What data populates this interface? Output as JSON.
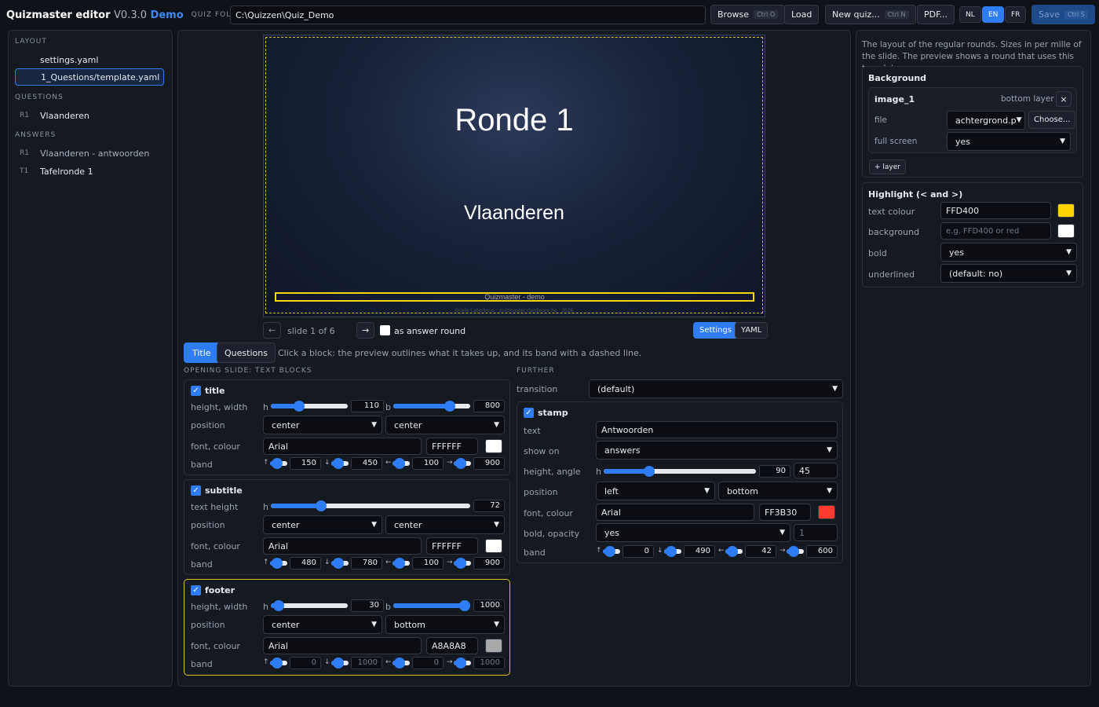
{
  "app": {
    "title": "Quizmaster editor",
    "version": "V0.3.0",
    "edition": "Demo",
    "folder_label": "QUIZ FOLDER",
    "folder_value": "C:\\Quizzen\\Quiz_Demo"
  },
  "toolbar": {
    "browse": "Browse",
    "browse_kbd": "Ctrl O",
    "load": "Load",
    "new_quiz": "New quiz...",
    "new_kbd": "Ctrl N",
    "pdf": "PDF...",
    "lang_nl": "NL",
    "lang_en": "EN",
    "lang_fr": "FR",
    "save": "Save",
    "save_kbd": "Ctrl S"
  },
  "sidebar": {
    "layout_title": "LAYOUT",
    "layout_items": [
      "settings.yaml",
      "1_Questions/template.yaml"
    ],
    "questions_title": "QUESTIONS",
    "questions": [
      {
        "code": "R1",
        "name": "Vlaanderen"
      }
    ],
    "answers_title": "ANSWERS",
    "answers": [
      {
        "code": "R1",
        "name": "Vlaanderen - antwoorden"
      },
      {
        "code": "T1",
        "name": "Tafelronde 1"
      }
    ]
  },
  "preview": {
    "title": "Ronde 1",
    "subtitle": "Vlaanderen",
    "footer": "Quizmaster - demo",
    "credits": "Griele Caterbous · quizmaster.clardware.be · 2026",
    "slide_label": "slide 1 of 6",
    "prev": "←",
    "next": "→",
    "answer_round": "as answer round",
    "settings": "Settings",
    "yaml": "YAML"
  },
  "tabs": {
    "title": "Title",
    "questions": "Questions",
    "hint": "Click a block: the preview outlines what it takes up, and its band with a dashed line."
  },
  "blocks": {
    "section_title": "OPENING SLIDE: TEXT BLOCKS",
    "labels": {
      "height_width": "height, width",
      "position": "position",
      "font_colour": "font, colour",
      "band": "band",
      "text_height": "text height",
      "h": "h",
      "b": "b",
      "up": "↑",
      "down": "↓",
      "left": "←",
      "right": "→"
    },
    "title": {
      "name": "title",
      "h": 110,
      "w": 800,
      "h_frac": 0.37,
      "w_frac": 0.73,
      "pos1": "center",
      "pos2": "center",
      "font": "Arial",
      "colour": "FFFFFF",
      "swatch": "#ffffff",
      "band": [
        150,
        450,
        100,
        900
      ]
    },
    "subtitle": {
      "name": "subtitle",
      "h": 72,
      "h_frac": 0.25,
      "pos1": "center",
      "pos2": "center",
      "font": "Arial",
      "colour": "FFFFFF",
      "swatch": "#ffffff",
      "band": [
        480,
        780,
        100,
        900
      ]
    },
    "footer": {
      "name": "footer",
      "h": 30,
      "w": 1000,
      "h_frac": 0.1,
      "w_frac": 1.0,
      "pos1": "center",
      "pos2": "bottom",
      "font": "Arial",
      "colour": "A8A8A8",
      "swatch": "#a8a8a8",
      "band": [
        0,
        1000,
        0,
        1000
      ]
    }
  },
  "further": {
    "section_title": "FURTHER",
    "transition_label": "transition",
    "transition_value": "(default)",
    "stamp": {
      "name": "stamp",
      "text_label": "text",
      "text": "Antwoorden",
      "show_label": "show on",
      "show": "answers",
      "ha_label": "height, angle",
      "h": 90,
      "angle": 45,
      "h_frac": 0.3,
      "pos_label": "position",
      "pos1": "left",
      "pos2": "bottom",
      "fc_label": "font, colour",
      "font": "Arial",
      "colour": "FF3B30",
      "swatch": "#ff3b30",
      "bo_label": "bold, opacity",
      "bold": "yes",
      "opacity": "1",
      "band_label": "band",
      "band": [
        0,
        490,
        42,
        600
      ]
    }
  },
  "right": {
    "intro": "The layout of the regular rounds. Sizes in per mille of the slide. The preview shows a round that uses this template.",
    "background": {
      "title": "Background",
      "layer": "image_1",
      "layer_pos": "bottom layer",
      "close": "×",
      "file_label": "file",
      "file": "achtergrond.p",
      "choose": "Choose...",
      "fullscreen_label": "full screen",
      "fullscreen": "yes",
      "add": "+ layer"
    },
    "highlight": {
      "title": "Highlight (< and >)",
      "text_colour_label": "text colour",
      "text_colour": "FFD400",
      "text_swatch": "#ffd400",
      "bg_label": "background",
      "bg_placeholder": "e.g. FFD400 or red",
      "bg_swatch": "#ffffff",
      "bold_label": "bold",
      "bold": "yes",
      "underlined_label": "underlined",
      "underlined": "(default: no)"
    }
  },
  "colors": {
    "accent": "#2e7cf6",
    "highlight": "#ffd400"
  }
}
